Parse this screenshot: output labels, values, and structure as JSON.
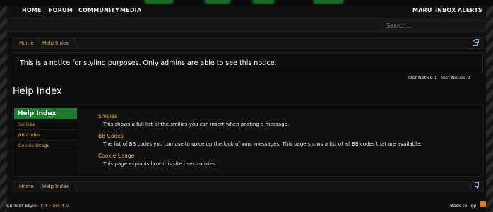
{
  "nav": {
    "left": [
      "HOME",
      "FORUM",
      "COMMUNITY",
      "MEDIA"
    ],
    "right": [
      "MARU",
      "INBOX",
      "ALERTS"
    ]
  },
  "search": {
    "placeholder": "Search..."
  },
  "breadcrumb": {
    "items": [
      "Home",
      "Help Index"
    ]
  },
  "notice": {
    "text": "This is a notice for styling purposes. Only admins are able to see this notice.",
    "tabs": [
      "Test Notice 1",
      "Test Notice 2"
    ]
  },
  "page_title": "Help Index",
  "sidebar": {
    "heading": "Help Index",
    "items": [
      "Smilies",
      "BB Codes",
      "Cookie Usage"
    ]
  },
  "help_entries": [
    {
      "title": "Smilies",
      "desc": "This shows a full list of the smilies you can insert when posting a message."
    },
    {
      "title": "BB Codes",
      "desc": "The list of BB codes you can use to spice up the look of your messages. This page shows a list of all BB codes that are available."
    },
    {
      "title": "Cookie Usage",
      "desc": "This page explains how this site uses cookies."
    }
  ],
  "footer": {
    "style_label": "Current Style:",
    "style_value": "XH-Flare 4.0",
    "back_to_top": "Back to Top"
  },
  "icons": {
    "jump": "jump-to-page-icon",
    "rss": "rss-icon"
  },
  "colors": {
    "accent": "#1f7a31",
    "link": "#e1a64a",
    "background": "#0f0f0f"
  }
}
